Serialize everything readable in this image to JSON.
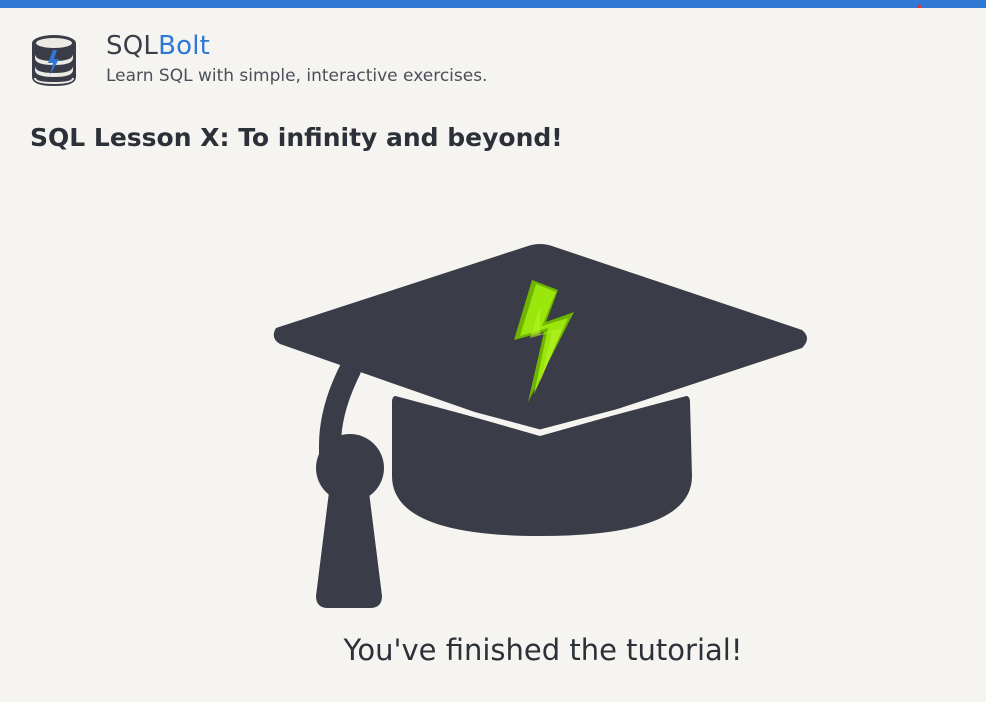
{
  "header": {
    "brand_prefix": "SQL",
    "brand_suffix": "Bolt",
    "tagline": "Learn SQL with simple, interactive exercises.",
    "logo_icon": "database-bolt-icon"
  },
  "lesson": {
    "title": "SQL Lesson X: To infinity and beyond!",
    "illustration_icon": "graduation-cap-bolt-icon",
    "message": "You've finished the tutorial!"
  },
  "colors": {
    "accent": "#2f78d4",
    "text_dark": "#2c3038",
    "cap": "#3a3d48",
    "bolt_green": "#8ee000",
    "background": "#f5f4f0"
  }
}
